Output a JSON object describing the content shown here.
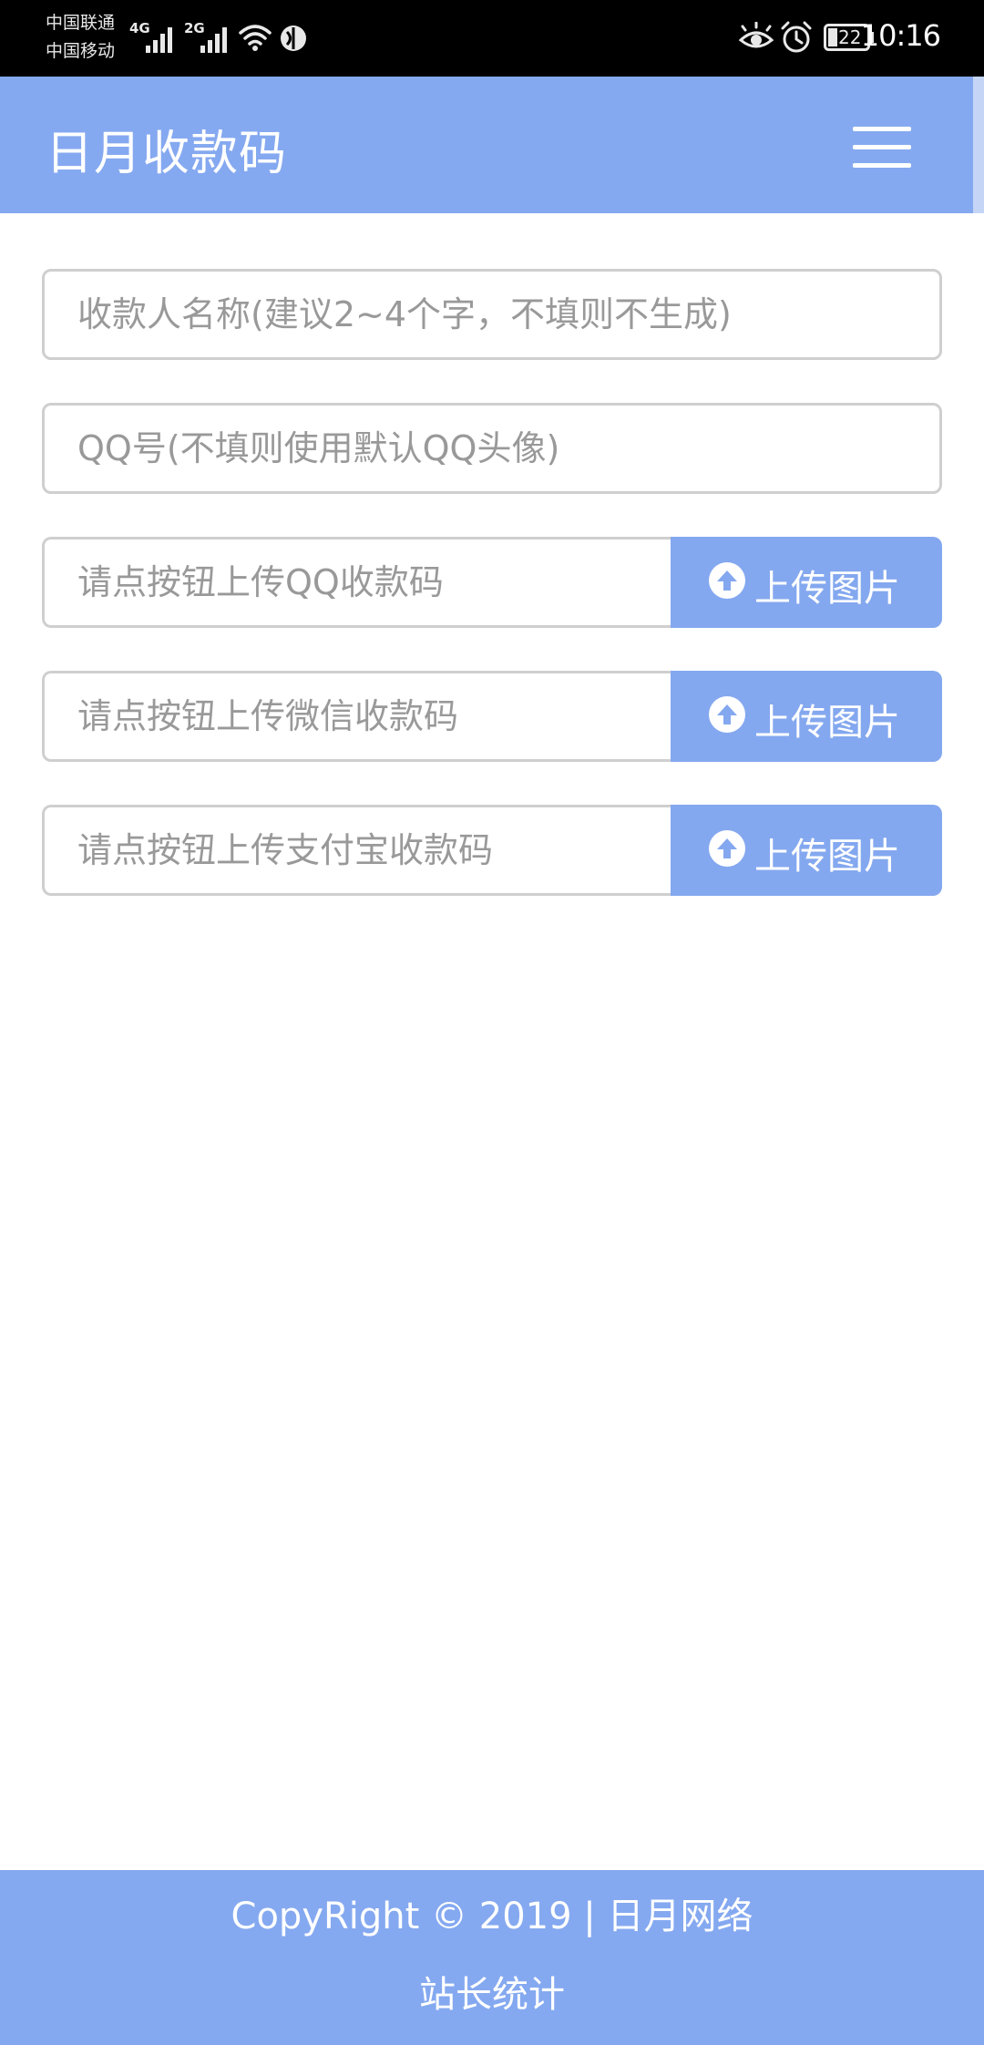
{
  "status_bar": {
    "carrier_1": "中国联通",
    "carrier_2": "中国移动",
    "net_1": "4G",
    "net_2": "2G",
    "battery": "22",
    "time": "10:16"
  },
  "header": {
    "title": "日月收款码",
    "menu_icon": "hamburger-menu-icon"
  },
  "form": {
    "payee_name": {
      "value": "",
      "placeholder": "收款人名称(建议2~4个字，不填则不生成)"
    },
    "qq_number": {
      "value": "",
      "placeholder": "QQ号(不填则使用默认QQ头像)"
    },
    "uploads": [
      {
        "placeholder": "请点按钮上传QQ收款码",
        "button_label": "上传图片",
        "icon": "upload-circle-icon"
      },
      {
        "placeholder": "请点按钮上传微信收款码",
        "button_label": "上传图片",
        "icon": "upload-circle-icon"
      },
      {
        "placeholder": "请点按钮上传支付宝收款码",
        "button_label": "上传图片",
        "icon": "upload-circle-icon"
      }
    ]
  },
  "footer": {
    "copyright": "CopyRight © 2019 | 日月网络",
    "stats_link": "站长统计"
  },
  "colors": {
    "accent": "#85a9f0",
    "status_bar": "#000000",
    "input_border": "#cfcfcf",
    "placeholder": "#999999"
  }
}
